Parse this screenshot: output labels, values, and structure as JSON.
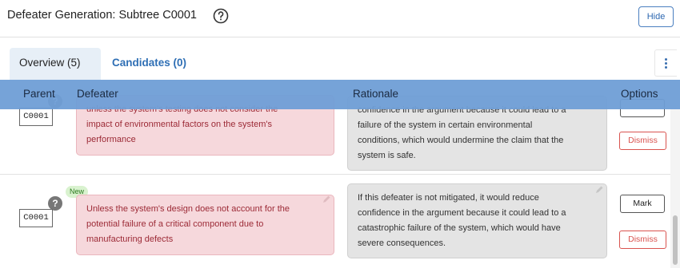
{
  "header": {
    "title": "Defeater Generation: Subtree C0001",
    "help_icon": "help-circle-icon",
    "hide_label": "Hide"
  },
  "tabs": [
    {
      "label": "Overview (5)",
      "active": true
    },
    {
      "label": "Candidates (0)",
      "active": false
    }
  ],
  "menu_icon": "kebab-menu-icon",
  "table": {
    "columns": [
      "Parent",
      "Defeater",
      "Rationale",
      "Options"
    ],
    "rows": [
      {
        "parent": "C0001",
        "badge": "",
        "defeater_lines": [
          "unless the system's testing does not consider the",
          "impact of environmental factors on the system's",
          "performance"
        ],
        "rationale_lines": [
          "confidence in the argument because it could lead to a",
          "failure of the system in certain environmental",
          "conditions, which would undermine the claim that the",
          "system is safe."
        ],
        "dismiss_label": "Dismiss"
      },
      {
        "parent": "C0001",
        "badge": "New",
        "defeater_lines": [
          "Unless the system's design does not account for the",
          "potential failure of a critical component due to",
          "manufacturing defects"
        ],
        "rationale_lines": [
          "If this defeater is not mitigated, it would reduce",
          "confidence in the argument because it could lead to a",
          "catastrophic failure of the system, which would have",
          "severe consequences."
        ],
        "mark_label": "Mark",
        "dismiss_label": "Dismiss"
      }
    ]
  },
  "colors": {
    "table_header": "#6f9ed6",
    "defeater_bg": "#f6d8dc",
    "defeater_text": "#9c2a36",
    "rationale_bg": "#e4e4e4",
    "accent": "#2f6fb5",
    "danger": "#d9534f",
    "new_badge_bg": "#d9f2cf"
  }
}
